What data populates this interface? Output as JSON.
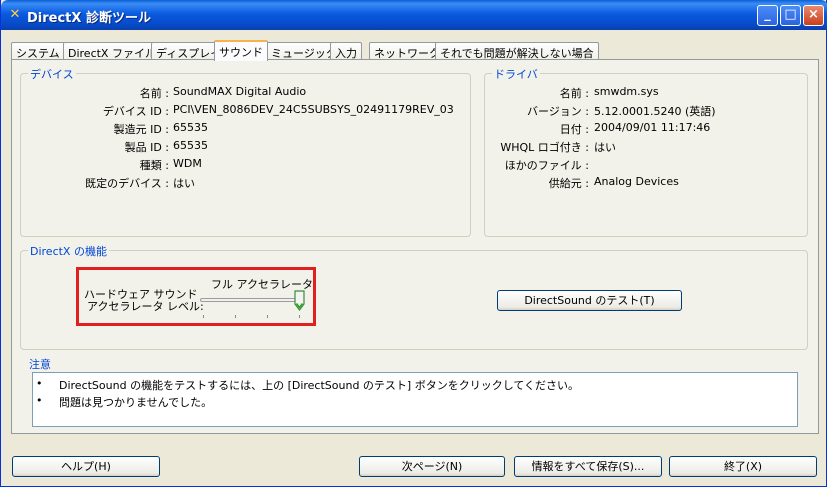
{
  "window": {
    "title": "DirectX 診断ツール"
  },
  "titlebar_buttons": {
    "minimize": "_",
    "maximize": "□",
    "close": "×"
  },
  "tabs": [
    "システム",
    "DirectX ファイル",
    "ディスプレイ",
    "サウンド",
    "ミュージック",
    "入力",
    "ネットワーク",
    "それでも問題が解決しない場合"
  ],
  "active_tab": "サウンド",
  "device": {
    "title": "デバイス",
    "fields": [
      {
        "label": "名前 :",
        "value": "SoundMAX Digital Audio"
      },
      {
        "label": "デバイス ID :",
        "value": "PCI\\VEN_8086DEV_24C5SUBSYS_02491179REV_03"
      },
      {
        "label": "製造元 ID :",
        "value": "65535"
      },
      {
        "label": "製品 ID :",
        "value": "65535"
      },
      {
        "label": "種類 :",
        "value": "WDM"
      },
      {
        "label": "既定のデバイス :",
        "value": "はい"
      }
    ]
  },
  "driver": {
    "title": "ドライバ",
    "fields": [
      {
        "label": "名前 :",
        "value": "smwdm.sys"
      },
      {
        "label": "バージョン :",
        "value": "5.12.0001.5240 (英語)"
      },
      {
        "label": "日付 :",
        "value": "2004/09/01 11:17:46"
      },
      {
        "label": "WHQL ロゴ付き :",
        "value": "はい"
      },
      {
        "label": "ほかのファイル :",
        "value": ""
      },
      {
        "label": "供給元 :",
        "value": "Analog Devices"
      }
    ]
  },
  "directx_features": {
    "title": "DirectX の機能",
    "hw_label_line1": "ハードウェア サウンド",
    "hw_label_line2": "アクセラレータ レベル:",
    "slider_value_label": "フル アクセラレータ",
    "slider_level_fraction": 1.0,
    "test_button": "DirectSound のテスト(T)"
  },
  "notes": {
    "title": "注意",
    "items": [
      "DirectSound の機能をテストするには、上の [DirectSound のテスト] ボタンをクリックしてください。",
      "問題は見つかりませんでした。"
    ]
  },
  "footer": {
    "help": "ヘルプ(H)",
    "next": "次ページ(N)",
    "save": "情報をすべて保存(S)...",
    "exit": "終了(X)"
  },
  "colors": {
    "titlebar": "#0a5be0",
    "group_title": "#0046d5",
    "highlight": "#e02020",
    "face": "#ece9d8"
  }
}
